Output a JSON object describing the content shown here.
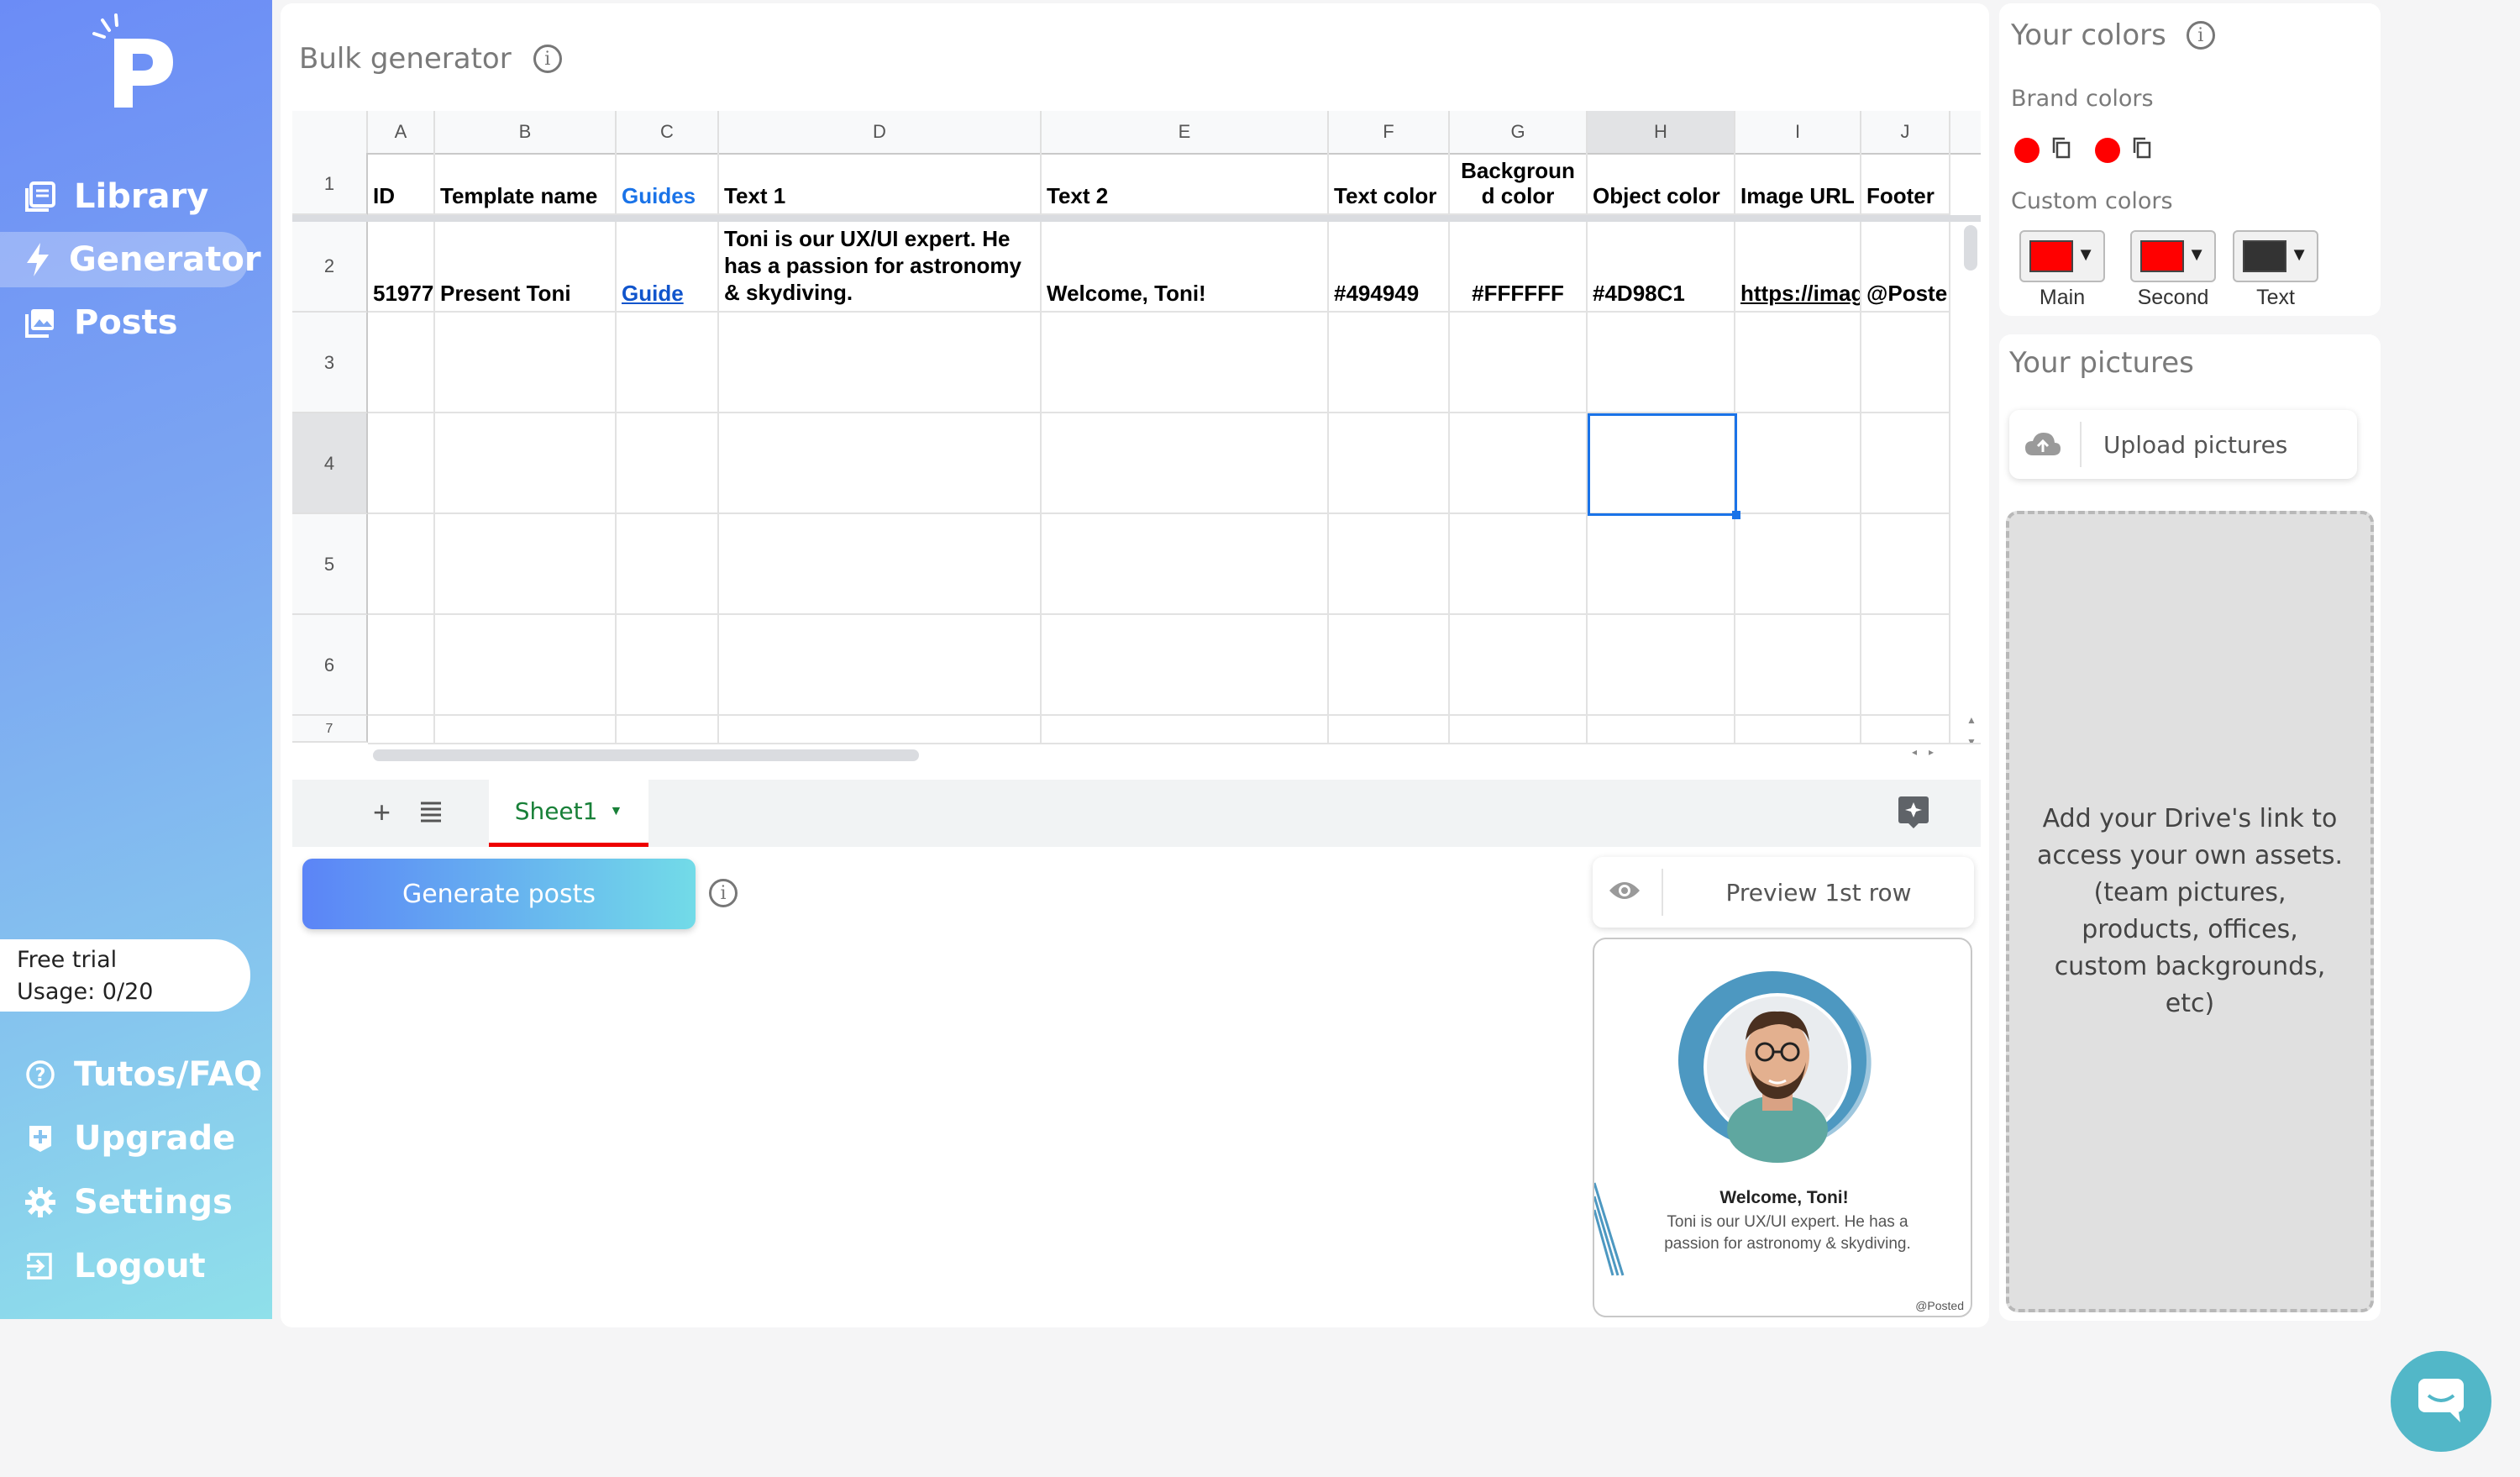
{
  "sidebar": {
    "nav_top": [
      {
        "label": "Library",
        "icon": "library-icon"
      },
      {
        "label": "Generator",
        "icon": "bolt-icon",
        "active": true
      },
      {
        "label": "Posts",
        "icon": "image-icon"
      }
    ],
    "trial": {
      "line1": "Free trial",
      "line2": "Usage: 0/20"
    },
    "nav_bottom": [
      {
        "label": "Tutos/FAQ",
        "icon": "help-icon"
      },
      {
        "label": "Upgrade",
        "icon": "upgrade-icon"
      },
      {
        "label": "Settings",
        "icon": "gear-icon"
      },
      {
        "label": "Logout",
        "icon": "logout-icon"
      }
    ]
  },
  "main": {
    "title": "Bulk generator",
    "sheet": {
      "columns": [
        "A",
        "B",
        "C",
        "D",
        "E",
        "F",
        "G",
        "H",
        "I",
        "J"
      ],
      "rows": [
        "1",
        "2",
        "3",
        "4",
        "5",
        "6",
        "7"
      ],
      "headers": [
        "ID",
        "Template name",
        "Guides",
        "Text 1",
        "Text 2",
        "Text color",
        "Backgroun d color",
        "Object color",
        "Image URL",
        "Footer"
      ],
      "row2": [
        "51977",
        "Present Toni",
        "Guide",
        "Toni is our UX/UI expert. He has a passion for astronomy & skydiving.",
        "Welcome, Toni!",
        "#494949",
        "#FFFFFF",
        "#4D98C1",
        "https://imag",
        "@Poste"
      ],
      "tab_name": "Sheet1"
    },
    "generate_label": "Generate posts",
    "preview_label": "Preview 1st row",
    "preview_card": {
      "title": "Welcome, Toni!",
      "body": "Toni is our UX/UI expert. He has a passion for astronomy & skydiving.",
      "footer": "@Posted",
      "accent": "#4D98C1"
    }
  },
  "colors": {
    "title": "Your colors",
    "brand_label": "Brand colors",
    "custom_label": "Custom colors",
    "swatches": [
      {
        "label": "Main",
        "color": "#ff0000"
      },
      {
        "label": "Second",
        "color": "#ff0000"
      },
      {
        "label": "Text",
        "color": "#333333"
      }
    ]
  },
  "pictures": {
    "title": "Your pictures",
    "upload_label": "Upload pictures",
    "drop_text": "Add your Drive's link to access your own assets. (team pictures, products, offices, custom backgrounds, etc)"
  }
}
